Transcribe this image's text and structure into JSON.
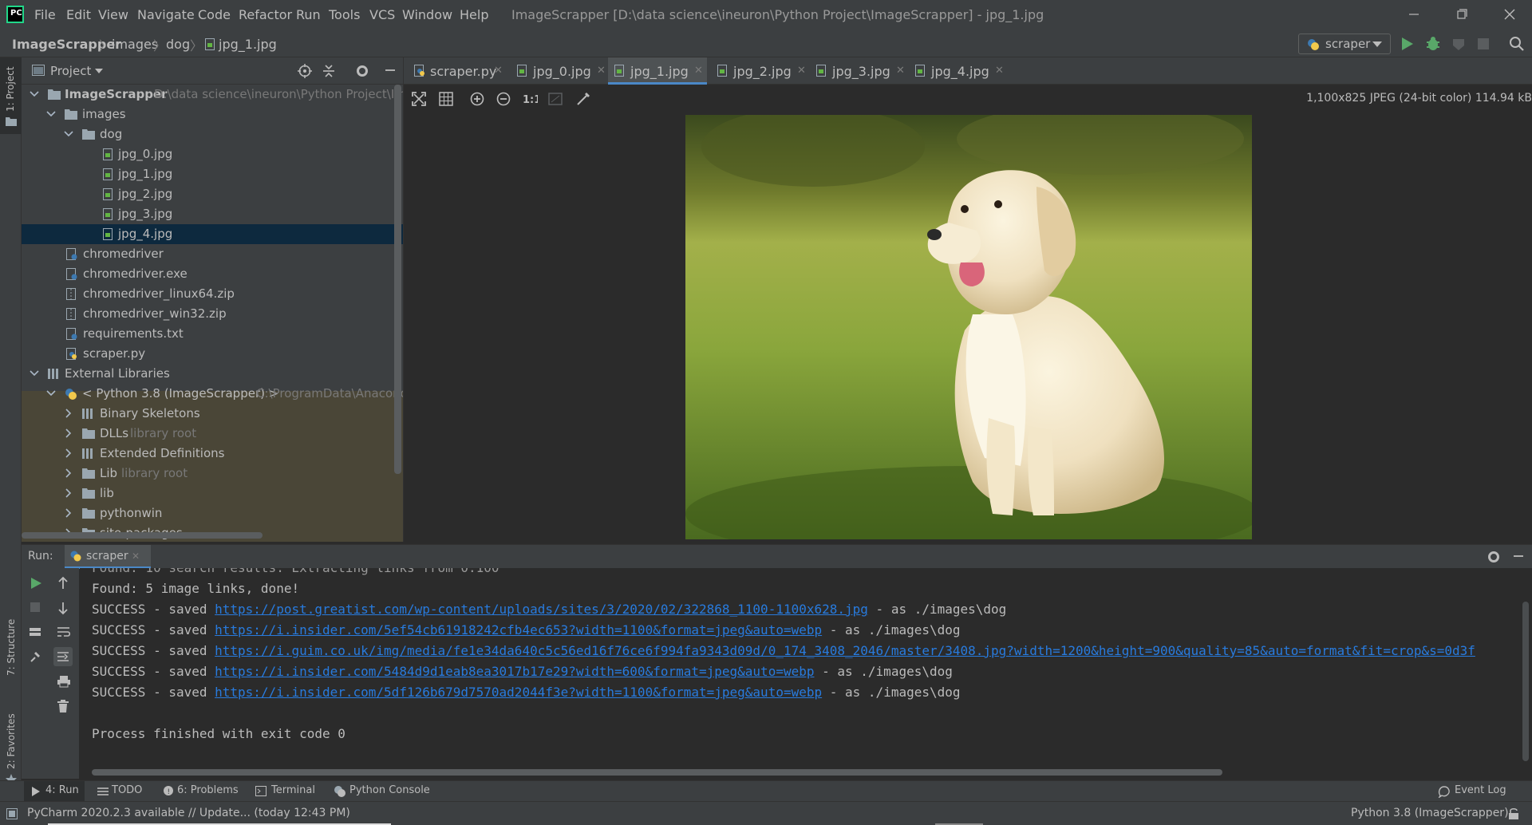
{
  "menu": [
    "File",
    "Edit",
    "View",
    "Navigate",
    "Code",
    "Refactor",
    "Run",
    "Tools",
    "VCS",
    "Window",
    "Help"
  ],
  "window_title": "ImageScrapper [D:\\data science\\ineuron\\Python Project\\ImageScrapper] - jpg_1.jpg",
  "breadcrumb": [
    "ImageScrapper",
    "images",
    "dog",
    "jpg_1.jpg"
  ],
  "run_config": "scraper",
  "left_stripe": {
    "project": "1: Project",
    "structure": "7: Structure",
    "favorites": "2: Favorites"
  },
  "project_panel": {
    "title": "Project",
    "tree": [
      {
        "label": "ImageScrapper",
        "hint": "D:\\data science\\ineuron\\Python Project\\ImageS",
        "icon": "folder-icon",
        "bold": true
      },
      {
        "label": "images",
        "hint": "",
        "icon": "folder-icon"
      },
      {
        "label": "dog",
        "hint": "",
        "icon": "folder-icon"
      },
      {
        "label": "jpg_0.jpg",
        "hint": "",
        "icon": "image-file-icon"
      },
      {
        "label": "jpg_1.jpg",
        "hint": "",
        "icon": "image-file-icon"
      },
      {
        "label": "jpg_2.jpg",
        "hint": "",
        "icon": "image-file-icon"
      },
      {
        "label": "jpg_3.jpg",
        "hint": "",
        "icon": "image-file-icon"
      },
      {
        "label": "jpg_4.jpg",
        "hint": "",
        "icon": "image-file-icon",
        "selected": true
      },
      {
        "label": "chromedriver",
        "hint": "",
        "icon": "file-icon"
      },
      {
        "label": "chromedriver.exe",
        "hint": "",
        "icon": "file-icon"
      },
      {
        "label": "chromedriver_linux64.zip",
        "hint": "",
        "icon": "archive-icon"
      },
      {
        "label": "chromedriver_win32.zip",
        "hint": "",
        "icon": "archive-icon"
      },
      {
        "label": "requirements.txt",
        "hint": "",
        "icon": "text-file-icon"
      },
      {
        "label": "scraper.py",
        "hint": "",
        "icon": "python-file-icon"
      },
      {
        "label": "External Libraries",
        "hint": "",
        "icon": "library-icon"
      },
      {
        "label": "< Python 3.8 (ImageScrapper) >",
        "hint": "C:\\ProgramData\\Anaconda",
        "icon": "python-icon"
      },
      {
        "label": "Binary Skeletons",
        "hint": "",
        "icon": "library-icon"
      },
      {
        "label": "DLLs",
        "hint": "library root",
        "icon": "folder-icon"
      },
      {
        "label": "Extended Definitions",
        "hint": "",
        "icon": "library-icon"
      },
      {
        "label": "Lib",
        "hint": "library root",
        "icon": "folder-icon"
      },
      {
        "label": "lib",
        "hint": "",
        "icon": "folder-icon"
      },
      {
        "label": "pythonwin",
        "hint": "",
        "icon": "folder-icon"
      },
      {
        "label": "site-packages",
        "hint": "",
        "icon": "folder-icon"
      }
    ]
  },
  "tabs": [
    {
      "label": "scraper.py",
      "icon": "python-file-icon"
    },
    {
      "label": "jpg_0.jpg",
      "icon": "image-file-icon"
    },
    {
      "label": "jpg_1.jpg",
      "icon": "image-file-icon",
      "active": true
    },
    {
      "label": "jpg_2.jpg",
      "icon": "image-file-icon"
    },
    {
      "label": "jpg_3.jpg",
      "icon": "image-file-icon"
    },
    {
      "label": "jpg_4.jpg",
      "icon": "image-file-icon"
    }
  ],
  "image_info": "1,100x825 JPEG (24-bit color) 114.94 kB",
  "run_panel": {
    "label": "Run:",
    "tab": "scraper",
    "console": [
      {
        "prefix": "Found: 5 image links, done!",
        "link": "",
        "suffix": ""
      },
      {
        "prefix": "SUCCESS - saved ",
        "link": "https://post.greatist.com/wp-content/uploads/sites/3/2020/02/322868_1100-1100x628.jpg",
        "suffix": " - as ./images\\dog"
      },
      {
        "prefix": "SUCCESS - saved ",
        "link": "https://i.insider.com/5ef54cb61918242cfb4ec653?width=1100&format=jpeg&auto=webp",
        "suffix": " - as ./images\\dog"
      },
      {
        "prefix": "SUCCESS - saved ",
        "link": "https://i.guim.co.uk/img/media/fe1e34da640c5c56ed16f76ce6f994fa9343d09d/0_174_3408_2046/master/3408.jpg?width=1200&height=900&quality=85&auto=format&fit=crop&s=0d3f",
        "suffix": ""
      },
      {
        "prefix": "SUCCESS - saved ",
        "link": "https://i.insider.com/5484d9d1eab8ea3017b17e29?width=600&format=jpeg&auto=webp",
        "suffix": " - as ./images\\dog"
      },
      {
        "prefix": "SUCCESS - saved ",
        "link": "https://i.insider.com/5df126b679d7570ad2044f3e?width=1100&format=jpeg&auto=webp",
        "suffix": " - as ./images\\dog"
      },
      {
        "prefix": "",
        "link": "",
        "suffix": ""
      },
      {
        "prefix": "Process finished with exit code 0",
        "link": "",
        "suffix": ""
      }
    ]
  },
  "bottom_tabs": [
    {
      "label": "4: Run",
      "icon": "run-icon"
    },
    {
      "label": "TODO",
      "icon": "list-icon"
    },
    {
      "label": "6: Problems",
      "icon": "problems-icon"
    },
    {
      "label": "Terminal",
      "icon": "terminal-icon"
    },
    {
      "label": "Python Console",
      "icon": "python-console-icon"
    }
  ],
  "event_log": "Event Log",
  "status": {
    "update_text": "PyCharm 2020.2.3 available // Update... (today 12:43 PM)",
    "interpreter": "Python 3.8 (ImageScrapper)"
  },
  "colors": {
    "accent": "#4a88c7",
    "selection": "#0d293e",
    "link": "#287bde",
    "run_green": "#59a869"
  }
}
